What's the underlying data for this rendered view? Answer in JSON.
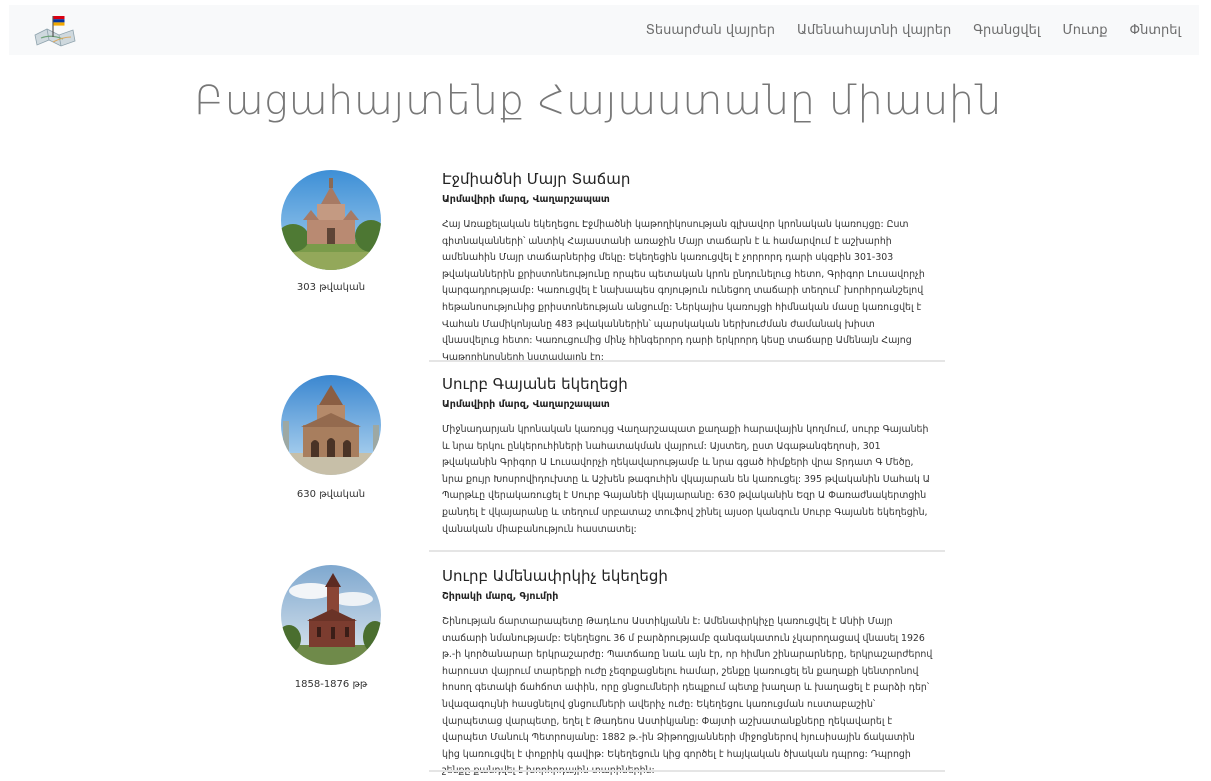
{
  "nav": {
    "links": [
      "Տեսարժան վայրեր",
      "Ամենահայտնի վայրեր",
      "Գրանցվել",
      "Մուտք",
      "Փնտրել"
    ]
  },
  "page": {
    "title": "Բացահայտենք Հայաստանը միասին"
  },
  "entries": [
    {
      "title": "Էջմիածնի Մայր Տաճար",
      "location": "Արմավիրի մարզ, Վաղարշապատ",
      "date": "303 թվական",
      "text": "Հայ Առաքելական եկեղեցու Էջմիածնի կաթողիկոսության գլխավոր կրոնական կառույցը: Ըստ գիտնականների՝ անտիկ Հայաստանի առաջին Մայր տաճարն է և համարվում է աշխարհի ամենահին Մայր տաճարներից մեկը: Եկեղեցին կառուցվել է չորրորդ դարի սկզբին 301-303 թվականներին քրիստոնեությունը որպես պետական կրոն ընդունելուց հետո, Գրիգոր Լուսավորչի կարգադրությամբ: Կառուցվել է նախապես գոյություն ունեցող տաճարի տեղում՝ խորհրդանշելով հեթանոսությունից քրիստոնեության անցումը: Ներկայիս կառույցի հիմնական մասը կառուցվել է Վահան Մամիկոնյանը 483 թվականներին՝ պարսկական ներխուժման ժամանակ խիստ վնասվելուց հետո: Կառուցումից մինչ հինգերորդ դարի երկրորդ կեսը տաճարը Ամենայն Հայոց Կաթողիկոսների նստավայրն էր:"
    },
    {
      "title": "Սուրբ Գայանե եկեղեցի",
      "location": "Արմավիրի մարզ, Վաղարշապատ",
      "date": "630 թվական",
      "text": "Միջնադարյան կրոնական կառույց Վաղարշապատ քաղաքի հարավային կողմում, սուրբ Գայանեի և նրա երկու ընկերուհիների նահատակման վայրում: Այստեղ, ըստ Ագաթանգեղոսի, 301 թվականին Գրիգոր Ա Լուսավորչի ղեկավարությամբ և նրա գցած հիմքերի վրա Տրդատ Գ Մեծը, նրա քույր Խոսրովիդուխտը և Աշխեն թագուհին վկայարան են կառուցել: 395 թվականին Սահակ Ա Պարթևը վերակառուցել է Սուրբ Գայանեի վկայարանը: 630 թվականին Եզր Ա Փառաժնակերտցին քանդել է վկայարանը և տեղում սրբատաշ տուֆով շինել այսօր կանգուն Սուրբ Գայանե եկեղեցին, վանական միաբանություն հաստատել:"
    },
    {
      "title": "Սուրբ Ամենափրկիչ եկեղեցի",
      "location": "Շիրակի մարզ, Գյումրի",
      "date": "1858-1876 թթ",
      "text": "Շինության ճարտարապետը Թադևոս Աստիկյանն է: Ամենափրկիչը կառուցվել է Անիի Մայր տաճարի նմանությամբ: Եկեղեցու 36 մ բարձրությամբ զանգակատուն չկարողացավ վնասել 1926 թ.-ի կործանարար երկրաշարժը: Պատճառը նաև այն էր, որ հիմնո շինարարները, երկրաշարժերով հարուստ վայրում տարերքի ուժը չեզոքացնելու համար, շենքը կառուցել են քաղաքի կենտրոնով հոսող գետակի ճահճոտ ափին, որը ցնցումների դեպքում պետք խաղար և խաղացել է բարձի դեր՝ նվազագույնի հասցնելով ցնցումների ավերիչ ուժը: Եկեղեցու կառուցման ուստաբաշին՝ վարպետաց վարպետը, եղել է Թադեոս Աստիկյանը: Փայտի աշխատանքները ղեկավարել է վարպետ Մանուկ Պետրոսյանը: 1882 թ.-ին Ձիթողցյանների միջոցներով հյուսիսային ճակատին կից կառուցվել է փոքրիկ գավիթ: Եկեղեցուն կից գործել է հայկական ծխական դպրոց: Դպրոցի շենքը քանդվել է խորհրդային տարիներին:"
    }
  ]
}
